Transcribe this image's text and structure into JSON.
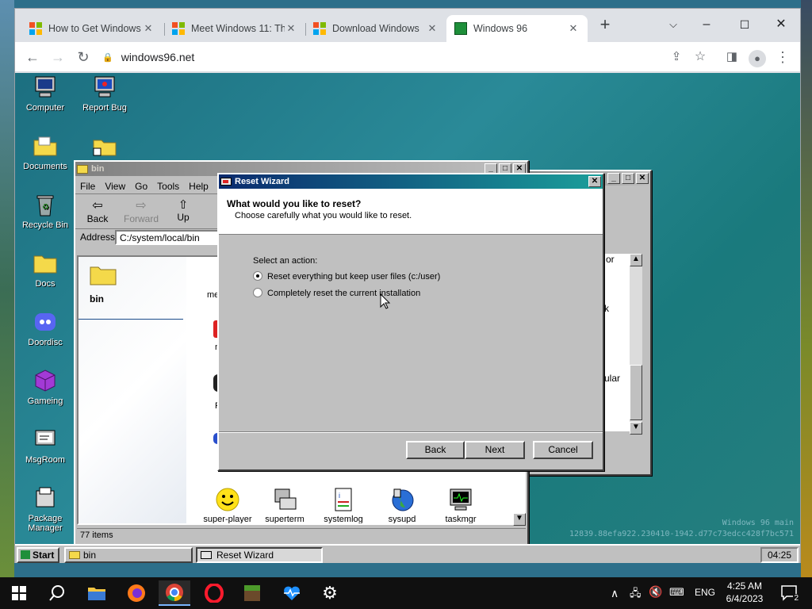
{
  "browser": {
    "tabs": [
      {
        "title": "How to Get Windows"
      },
      {
        "title": "Meet Windows 11: Th"
      },
      {
        "title": "Download Windows"
      },
      {
        "title": "Windows 96"
      }
    ],
    "new_tab_label": "+",
    "url": "windows96.net"
  },
  "desktop_icons": [
    {
      "label": "Computer"
    },
    {
      "label": "Report Bug"
    },
    {
      "label": "Documents"
    },
    {
      "label": "Recycle Bin"
    },
    {
      "label": "Docs"
    },
    {
      "label": "Doordisc"
    },
    {
      "label": "Gameing"
    },
    {
      "label": "MsgRoom"
    },
    {
      "label": "Package Manager"
    }
  ],
  "explorer": {
    "title": "bin",
    "menu": [
      "File",
      "View",
      "Go",
      "Tools",
      "Help"
    ],
    "toolbar": {
      "back": "Back",
      "forward": "Forward",
      "up": "Up"
    },
    "address_label": "Address",
    "address_value": "C:/system/local/bin",
    "sidebar_folder": "bin",
    "partial_label_1": "me",
    "partial_label_2": "n",
    "partial_label_3": "P",
    "files": [
      {
        "name": "super-player"
      },
      {
        "name": "superterm"
      },
      {
        "name": "systemlog"
      },
      {
        "name": "sysupd"
      },
      {
        "name": "taskmgr"
      }
    ],
    "status": "77 items"
  },
  "back_window": {
    "fragments": [
      "or",
      "k",
      "ular"
    ]
  },
  "wizard": {
    "title": "Reset Wizard",
    "heading": "What would you like to reset?",
    "subheading": "Choose carefully what you would like to reset.",
    "prompt": "Select an action:",
    "options": [
      {
        "label": "Reset everything but keep user files (c:/user)",
        "selected": true
      },
      {
        "label": "Completely reset the current installation",
        "selected": false
      }
    ],
    "buttons": {
      "back": "Back",
      "next": "Next",
      "cancel": "Cancel"
    }
  },
  "watermark": {
    "line1": "Windows 96 main",
    "line2": "12839.88efa922.230410-1942.d77c73edcc428f7bc571"
  },
  "taskbar96": {
    "start": "Start",
    "tasks": [
      {
        "label": "bin"
      },
      {
        "label": "Reset Wizard"
      }
    ],
    "clock": "04:25"
  },
  "win10": {
    "lang": "ENG",
    "time": "4:25 AM",
    "date": "6/4/2023",
    "notification_count": "2"
  },
  "colors": {
    "w96_title_active": "#0a2a6e",
    "w96_face": "#c0c0c0",
    "desktop": "#2a8a98"
  }
}
